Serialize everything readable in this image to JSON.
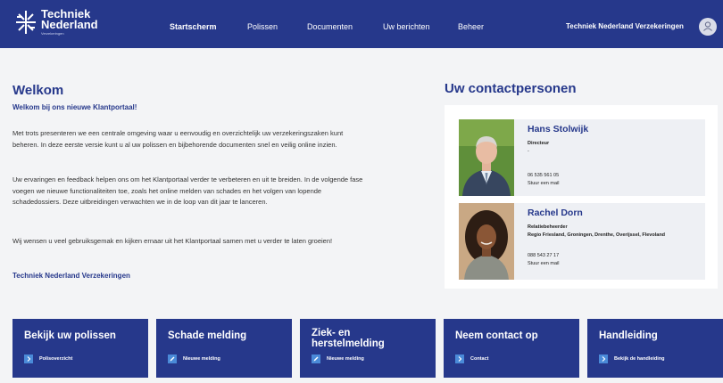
{
  "header": {
    "logo": {
      "line1": "Techniek",
      "line2": "Nederland",
      "line3": "Verzekeringen"
    },
    "nav": [
      "Startscherm",
      "Polissen",
      "Documenten",
      "Uw berichten",
      "Beheer"
    ],
    "active_nav": "Startscherm",
    "company": "Techniek Nederland Verzekeringen",
    "avatar_icon": "user-icon"
  },
  "welcome": {
    "title": "Welkom",
    "subtitle": "Welkom bij ons nieuwe Klantportaal!",
    "paragraphs": [
      "Met trots presenteren we een centrale omgeving waar u eenvoudig en overzichtelijk uw verzekeringszaken kunt beheren. In deze eerste versie kunt u al uw polissen en bijbehorende documenten snel en veilig online inzien.",
      "Uw ervaringen en feedback helpen ons om het Klantportaal verder te verbeteren en uit te breiden. In de volgende fase voegen we nieuwe functionaliteiten toe, zoals het online melden van schades en het volgen van lopende schadedossiers. Deze uitbreidingen verwachten we in de loop van dit jaar te lanceren.",
      "Wij wensen u veel gebruiksgemak en kijken ernaar uit het Klantportaal samen met u verder te laten groeien!"
    ],
    "signature": "Techniek Nederland Verzekeringen"
  },
  "contacts": {
    "title": "Uw contactpersonen",
    "people": [
      {
        "name": "Hans Stolwijk",
        "role": "Directeur",
        "region": "-",
        "phone": "06 535 561 05",
        "mail": "Stuur een mail"
      },
      {
        "name": "Rachel Dorn",
        "role": "Relatiebeheerder",
        "region": "Regio Friesland, Groningen, Drenthe, Overijssel, Flevoland",
        "phone": "088 543 27 17",
        "mail": "Stuur een mail"
      }
    ]
  },
  "tiles": [
    {
      "title": "Bekijk uw polissen",
      "link": "Polisoverzicht",
      "icon": "chevron-right-icon"
    },
    {
      "title": "Schade melding",
      "link": "Nieuwe melding",
      "icon": "edit-icon"
    },
    {
      "title": "Ziek- en herstelmelding",
      "link": "Nieuwe melding",
      "icon": "edit-icon"
    },
    {
      "title": "Neem contact op",
      "link": "Contact",
      "icon": "chevron-right-icon"
    },
    {
      "title": "Handleiding",
      "link": "Bekijk de handleiding",
      "icon": "chevron-right-icon"
    }
  ],
  "colors": {
    "primary": "#26388b",
    "accent": "#4a8ad8",
    "background": "#f3f4f6"
  }
}
